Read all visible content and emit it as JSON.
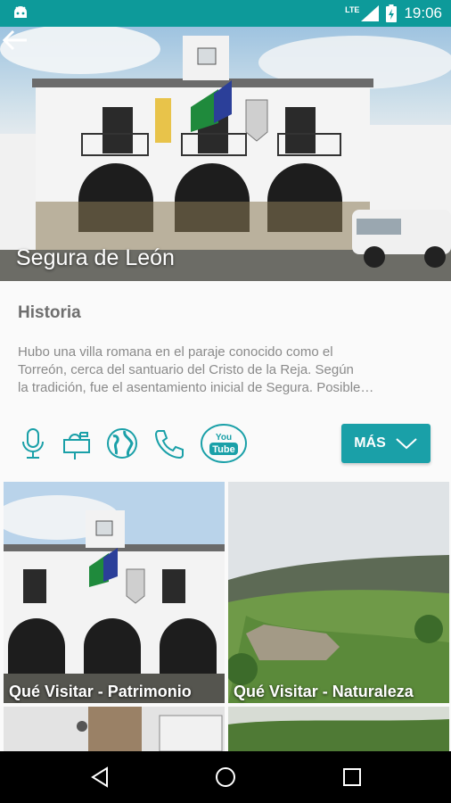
{
  "status_bar": {
    "network": "LTE",
    "time": "19:06"
  },
  "hero": {
    "title": "Segura de León"
  },
  "historia": {
    "title": "Historia",
    "lines": [
      "Hubo una villa romana en el paraje conocido como el",
      "Torreón, cerca del santuario del Cristo de la Reja. Según",
      "la tradición, fue el asentamiento inicial de Segura. Posible…"
    ]
  },
  "actions": {
    "icons": [
      "microphone-icon",
      "mailbox-icon",
      "globe-icon",
      "phone-icon",
      "youtube-icon"
    ],
    "youtube_label": [
      "You",
      "Tube"
    ],
    "more_label": "MÁS"
  },
  "cards": [
    {
      "label": "Qué Visitar - Patrimonio"
    },
    {
      "label": "Qué Visitar - Naturaleza"
    },
    {
      "label": ""
    },
    {
      "label": ""
    }
  ],
  "colors": {
    "accent": "#1aa0a8",
    "status_bar": "#0d9a9a"
  }
}
